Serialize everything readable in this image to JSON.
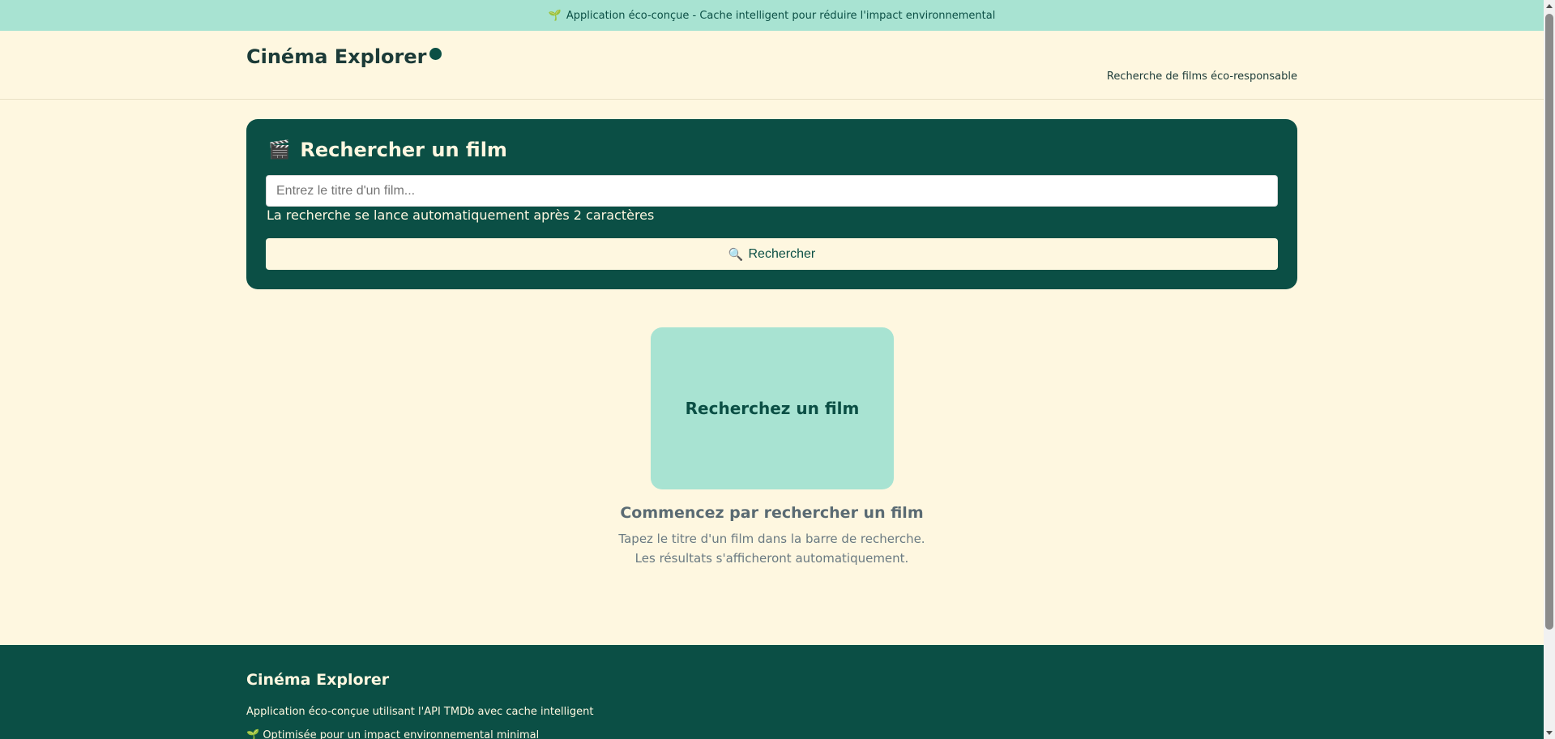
{
  "banner": {
    "icon": "sprout-icon",
    "text": "Application éco-conçue - Cache intelligent pour réduire l'impact environnemental"
  },
  "header": {
    "brand": "Cinéma Explorer",
    "tagline": "Recherche de films éco-responsable"
  },
  "search": {
    "title": "Rechercher un film",
    "title_icon": "clapperboard-icon",
    "placeholder": "Entrez le titre d'un film...",
    "value": "",
    "hint": "La recherche se lance automatiquement après 2 caractères",
    "button_label": "Rechercher",
    "button_icon": "magnifier-icon"
  },
  "empty_state": {
    "tile_label": "Recherchez un film",
    "heading": "Commencez par rechercher un film",
    "line1": "Tapez le titre d'un film dans la barre de recherche.",
    "line2": "Les résultats s'afficheront automatiquement."
  },
  "footer": {
    "title": "Cinéma Explorer",
    "description": "Application éco-conçue utilisant l'API TMDb avec cache intelligent",
    "note": "Optimisée pour un impact environnemental minimal"
  },
  "colors": {
    "primary": "#0b4f45",
    "accent": "#a8e3d2",
    "background": "#fef7e0"
  }
}
